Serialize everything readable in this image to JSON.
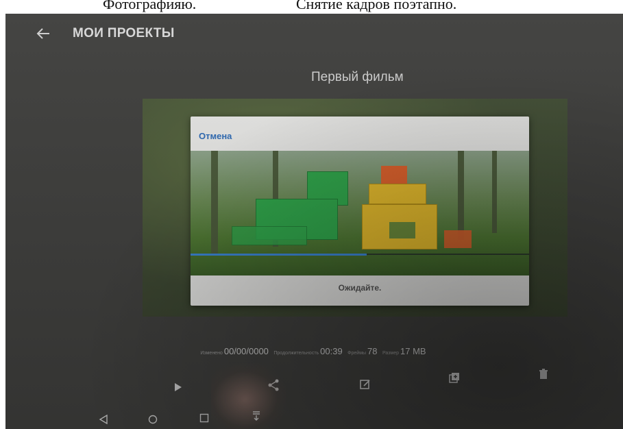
{
  "caption": {
    "left": "Фотографияю.",
    "right": "Снятие кадров поэтапно."
  },
  "header": {
    "title": "МОИ ПРОЕКТЫ"
  },
  "project": {
    "title": "Первый фильм"
  },
  "dialog": {
    "cancel_label": "Отмена",
    "status_text": "Ожидайте.",
    "progress_fraction": 0.52
  },
  "info": {
    "modified_label": "Изменено",
    "modified_value": "00/00/0000",
    "duration_label": "Продолжительность",
    "duration_value": "00:39",
    "frames_label": "Фреймы",
    "frames_value": "78",
    "size_label": "Размер",
    "size_value": "17 MB"
  },
  "actions": [
    "play-icon",
    "share-icon",
    "edit-icon",
    "duplicate-icon",
    "delete-icon"
  ],
  "navigation": [
    "back-icon",
    "home-icon",
    "recents-icon",
    "notification-icon"
  ],
  "colors": {
    "screen_bg": "#3f3f3d",
    "link_blue": "#2d6ab5",
    "progress_blue": "#3a86d9",
    "dialog_bg": "#e7e7e5"
  }
}
